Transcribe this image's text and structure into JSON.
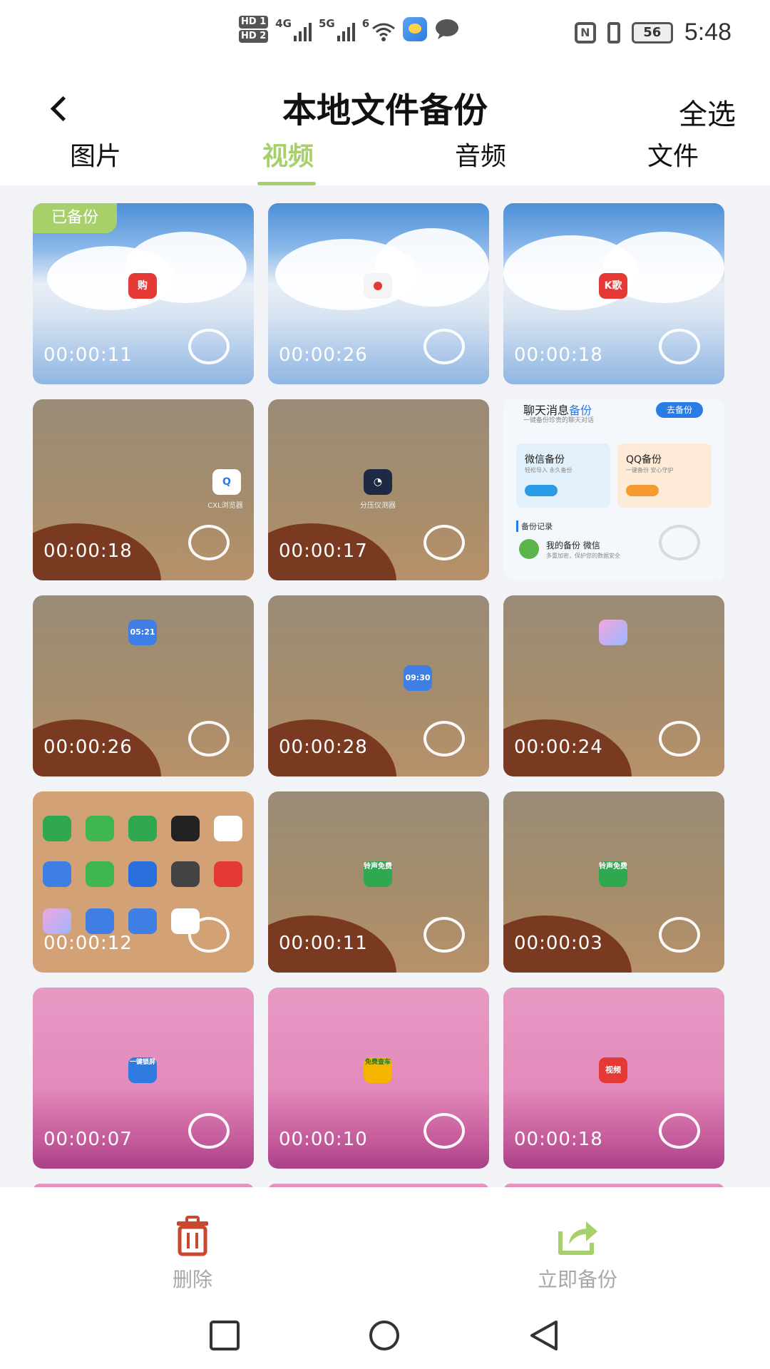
{
  "status_bar": {
    "hd1": "HD 1",
    "hd2": "HD 2",
    "net1": "4G",
    "net2": "5G",
    "wifi": "6",
    "battery": "56",
    "time": "5:48",
    "icons": [
      "wifi-icon",
      "weather-app-icon",
      "message-icon",
      "nfc-icon",
      "vibrate-icon",
      "battery-icon"
    ]
  },
  "header": {
    "title": "本地文件备份",
    "select_all": "全选"
  },
  "tabs": [
    {
      "label": "图片",
      "active": false
    },
    {
      "label": "视频",
      "active": true
    },
    {
      "label": "音频",
      "active": false
    },
    {
      "label": "文件",
      "active": false
    }
  ],
  "accent_color": "#a8d06a",
  "backed_up_badge": "已备份",
  "videos": [
    {
      "duration": "00:00:11",
      "bg": "sky",
      "backed_up": true
    },
    {
      "duration": "00:00:26",
      "bg": "sky",
      "backed_up": false
    },
    {
      "duration": "00:00:18",
      "bg": "sky",
      "backed_up": false
    },
    {
      "duration": "00:00:18",
      "bg": "desert",
      "backed_up": false
    },
    {
      "duration": "00:00:17",
      "bg": "desert",
      "backed_up": false
    },
    {
      "duration": "",
      "bg": "chat",
      "backed_up": false
    },
    {
      "duration": "00:00:26",
      "bg": "desert",
      "backed_up": false
    },
    {
      "duration": "00:00:28",
      "bg": "desert",
      "backed_up": false
    },
    {
      "duration": "00:00:24",
      "bg": "desert",
      "backed_up": false
    },
    {
      "duration": "00:00:12",
      "bg": "screens",
      "backed_up": false
    },
    {
      "duration": "00:00:11",
      "bg": "desert",
      "backed_up": false
    },
    {
      "duration": "00:00:03",
      "bg": "desert",
      "backed_up": false
    },
    {
      "duration": "00:00:07",
      "bg": "pink",
      "backed_up": false
    },
    {
      "duration": "00:00:10",
      "bg": "pink",
      "backed_up": false
    },
    {
      "duration": "00:00:18",
      "bg": "pink",
      "backed_up": false
    }
  ],
  "thumb_text": {
    "t1_icon": "购",
    "t3_icon": "K歌",
    "t4_caption": "CXL浏览器",
    "t5_caption": "分压仪测器",
    "t6": {
      "title_a": "聊天消息",
      "title_b": "备份",
      "subtitle": "一键备份珍贵的聊天对话",
      "go_button": "去备份",
      "wechat": "微信备份",
      "wechat_sub": "轻松导入 永久备份",
      "qq": "QQ备份",
      "qq_sub": "一键备份 安心守护",
      "record": "备份记录",
      "item": "我的备份 微信",
      "item_sub": "多重加密，保护您的数据安全"
    },
    "t7_icon": "05:21",
    "t8_icon": "09:30",
    "t11_icon": "铃声免费",
    "t12_icon": "铃声免费",
    "t13_icon": "一键锁屏",
    "t14_icon": "免费查车",
    "t15_icon": "视频"
  },
  "bottom": {
    "delete_label": "删除",
    "backup_label": "立即备份",
    "delete_color": "#c9462f",
    "backup_color": "#a8d06a"
  },
  "nav": [
    "recent-apps-icon",
    "home-icon",
    "back-triangle-icon"
  ]
}
